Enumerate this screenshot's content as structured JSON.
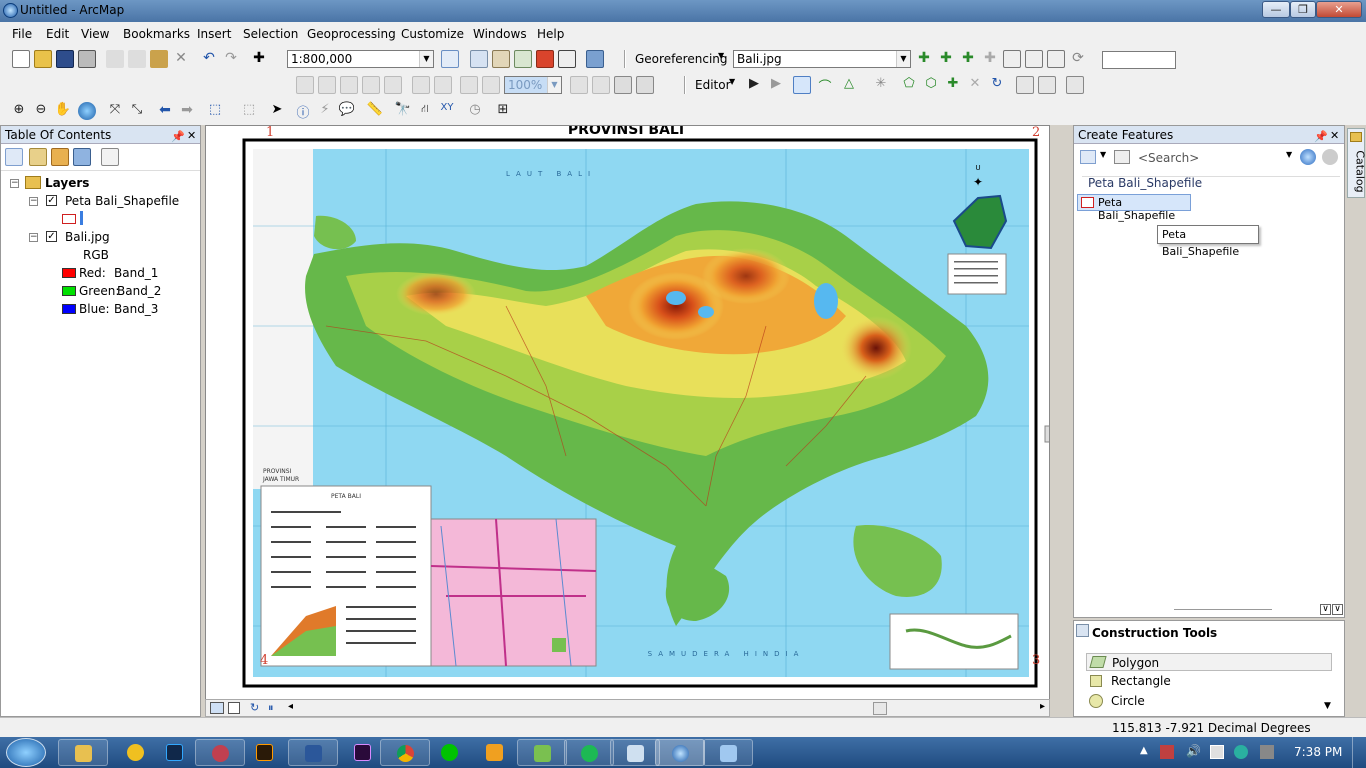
{
  "window": {
    "title": "Untitled - ArcMap",
    "min": "—",
    "max": "❐",
    "close": "✕"
  },
  "menus": [
    "File",
    "Edit",
    "View",
    "Bookmarks",
    "Insert",
    "Selection",
    "Geoprocessing",
    "Customize",
    "Windows",
    "Help"
  ],
  "toolbar": {
    "scale": "1:800,000",
    "georef_label": "Georeferencing",
    "georef_layer": "Bali.jpg",
    "transparency": "100%",
    "editor_label": "Editor"
  },
  "toc": {
    "title": "Table Of Contents",
    "root": "Layers",
    "layer1": "Peta Bali_Shapefile",
    "layer2": "Bali.jpg",
    "rgb": "RGB",
    "bands": [
      {
        "label": "Red:",
        "value": "Band_1",
        "color": "#ff0000"
      },
      {
        "label": "Green:",
        "value": "Band_2",
        "color": "#00e000"
      },
      {
        "label": "Blue:",
        "value": "Band_3",
        "color": "#0000ff"
      }
    ]
  },
  "map": {
    "title": "PROVINSI BALI",
    "corner_labels": [
      "1",
      "2",
      "3",
      "4"
    ],
    "north": "U",
    "side_label": "PROVINSI",
    "side_label2": "JAWA TIMUR",
    "sea_south": "SAMUDERA HINDIA",
    "sea_north": "LAUT BALI",
    "legend_title": "PETA BALI"
  },
  "create_features": {
    "title": "Create Features",
    "search_placeholder": "<Search>",
    "group": "Peta Bali_Shapefile",
    "item": "Peta Bali_Shapefile",
    "tooltip": "Peta Bali_Shapefile"
  },
  "construction_tools": {
    "title": "Construction Tools",
    "items": [
      "Polygon",
      "Rectangle",
      "Circle"
    ]
  },
  "catalog_tab": "Catalog",
  "status": {
    "coords": "115.813  -7.921 Decimal Degrees"
  },
  "taskbar": {
    "time": "7:38 PM"
  }
}
